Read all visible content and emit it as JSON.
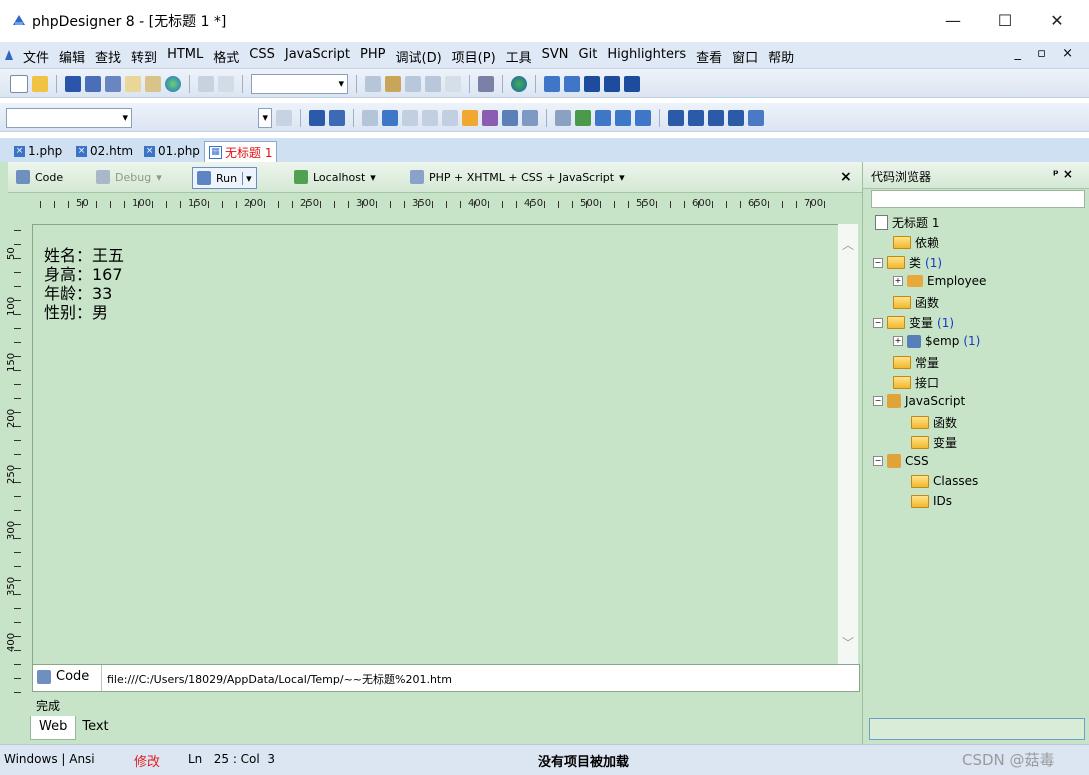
{
  "window": {
    "title": "phpDesigner 8 - [无标题 1 *]",
    "minimize": "—",
    "maximize": "☐",
    "close": "✕"
  },
  "menu": {
    "items": [
      "文件",
      "编辑",
      "查找",
      "转到",
      "HTML",
      "格式",
      "CSS",
      "JavaScript",
      "PHP",
      "调试(D)",
      "项目(P)",
      "工具",
      "SVN",
      "Git",
      "Highlighters",
      "查看",
      "窗口",
      "帮助"
    ],
    "mdi_controls": "_ ▫ ×"
  },
  "tabs": [
    {
      "label": "1.php"
    },
    {
      "label": "02.htm"
    },
    {
      "label": "01.php"
    },
    {
      "label": "无标题 1"
    }
  ],
  "editor_toolbar": {
    "code": "Code",
    "debug": "Debug",
    "run": "Run",
    "localhost": "Localhost",
    "profile": "PHP + XHTML + CSS + JavaScript",
    "close": "×"
  },
  "ruler": {
    "h_labels": [
      "50",
      "100",
      "150",
      "200",
      "250",
      "300",
      "350",
      "400",
      "450",
      "500",
      "550",
      "600",
      "650",
      "700"
    ],
    "v_labels": [
      "50",
      "100",
      "150",
      "200",
      "250",
      "300",
      "350",
      "400"
    ]
  },
  "content": {
    "lines": [
      "姓名：王五",
      "身高：167",
      "年龄：33",
      "性别：男"
    ]
  },
  "code_bar": {
    "label": "Code",
    "path": "file:///C:/Users/18029/AppData/Local/Temp/~~无标题%201.htm"
  },
  "status_done": "完成",
  "view_tabs": [
    "Web",
    "Text"
  ],
  "code_browser": {
    "title": "代码浏览器",
    "pin": "ᵖ ×",
    "tree": {
      "root": "无标题 1",
      "dependency": "依赖",
      "classes": "类",
      "classes_count": "(1)",
      "employee": "Employee",
      "functions": "函数",
      "variables": "变量",
      "variables_count": "(1)",
      "emp": "$emp",
      "emp_count": "(1)",
      "constants": "常量",
      "interfaces": "接口",
      "javascript": "JavaScript",
      "js_functions": "函数",
      "js_variables": "变量",
      "css": "CSS",
      "css_classes": "Classes",
      "css_ids": "IDs"
    }
  },
  "statusbar": {
    "encoding": "Windows | Ansi",
    "modified": "修改",
    "position": "Ln   25 : Col  3",
    "message": "没有项目被加载",
    "watermark": "CSDN @菇毒"
  }
}
